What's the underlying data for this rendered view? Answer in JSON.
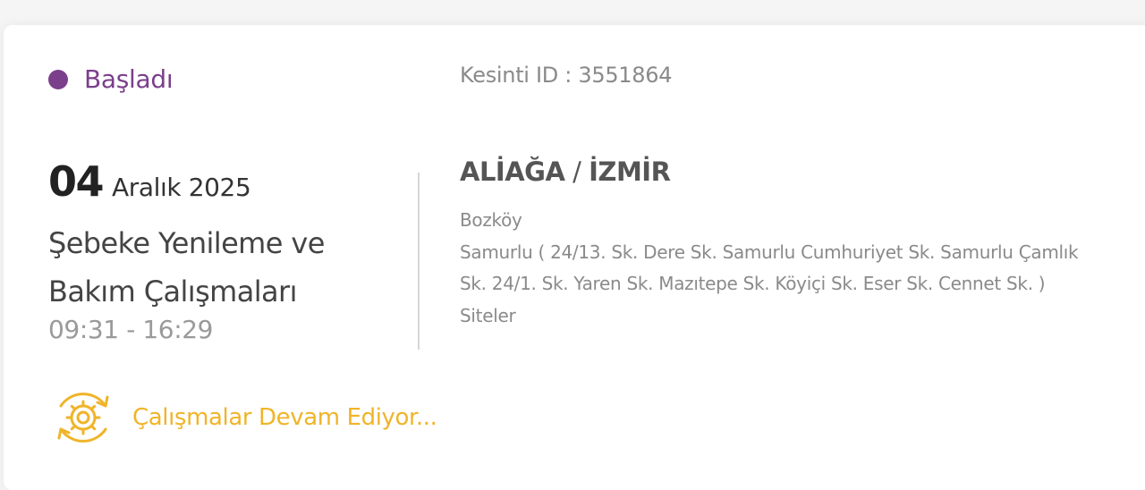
{
  "status": {
    "label": "Başladı",
    "color": "#7b3f8c"
  },
  "outage": {
    "id_text": "Kesinti ID : 3551864"
  },
  "date": {
    "day": "04",
    "month_year": "Aralık 2025"
  },
  "work": {
    "title_line1": "Şebeke Yenileme ve",
    "title_line2": "Bakım Çalışmaları",
    "time_range": "09:31 - 16:29"
  },
  "location": {
    "district": "ALİAĞA",
    "separator": " / ",
    "city": "İZMİR"
  },
  "details": [
    "Bozköy",
    "Samurlu ( 24/13. Sk. Dere Sk. Samurlu Cumhuriyet Sk. Samurlu Çamlık",
    "Sk. 24/1. Sk. Yaren Sk. Mazıtepe Sk. Köyiçi Sk. Eser Sk. Cennet Sk. )",
    "Siteler"
  ],
  "progress": {
    "label": "Çalışmalar Devam Ediyor...",
    "icon": "gear-refresh-icon",
    "color": "#f0b429"
  }
}
